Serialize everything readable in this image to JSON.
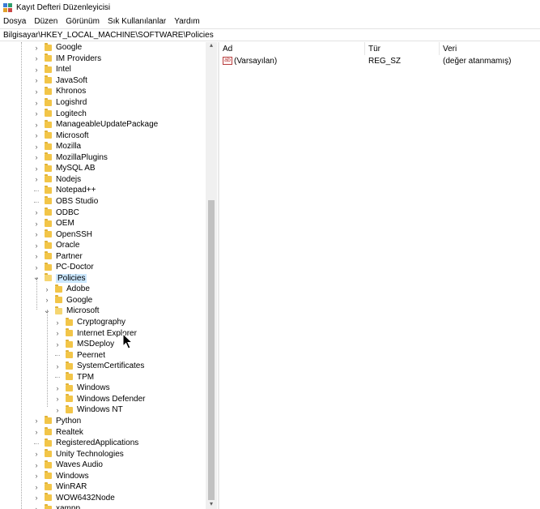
{
  "window": {
    "title": "Kayıt Defteri Düzenleyicisi"
  },
  "menu": [
    "Dosya",
    "Düzen",
    "Görünüm",
    "Sık Kullanılanlar",
    "Yardım"
  ],
  "address": "Bilgisayar\\HKEY_LOCAL_MACHINE\\SOFTWARE\\Policies",
  "tree": {
    "items": [
      {
        "label": "Google",
        "level": 1,
        "expanded": false,
        "has_children": true
      },
      {
        "label": "IM Providers",
        "level": 1,
        "expanded": false,
        "has_children": true
      },
      {
        "label": "Intel",
        "level": 1,
        "expanded": false,
        "has_children": true
      },
      {
        "label": "JavaSoft",
        "level": 1,
        "expanded": false,
        "has_children": true
      },
      {
        "label": "Khronos",
        "level": 1,
        "expanded": false,
        "has_children": true
      },
      {
        "label": "Logishrd",
        "level": 1,
        "expanded": false,
        "has_children": true
      },
      {
        "label": "Logitech",
        "level": 1,
        "expanded": false,
        "has_children": true
      },
      {
        "label": "ManageableUpdatePackage",
        "level": 1,
        "expanded": false,
        "has_children": true
      },
      {
        "label": "Microsoft",
        "level": 1,
        "expanded": false,
        "has_children": true
      },
      {
        "label": "Mozilla",
        "level": 1,
        "expanded": false,
        "has_children": true
      },
      {
        "label": "MozillaPlugins",
        "level": 1,
        "expanded": false,
        "has_children": true
      },
      {
        "label": "MySQL AB",
        "level": 1,
        "expanded": false,
        "has_children": true
      },
      {
        "label": "Nodejs",
        "level": 1,
        "expanded": false,
        "has_children": true
      },
      {
        "label": "Notepad++",
        "level": 1,
        "expanded": false,
        "has_children": false
      },
      {
        "label": "OBS Studio",
        "level": 1,
        "expanded": false,
        "has_children": false
      },
      {
        "label": "ODBC",
        "level": 1,
        "expanded": false,
        "has_children": true
      },
      {
        "label": "OEM",
        "level": 1,
        "expanded": false,
        "has_children": true
      },
      {
        "label": "OpenSSH",
        "level": 1,
        "expanded": false,
        "has_children": true
      },
      {
        "label": "Oracle",
        "level": 1,
        "expanded": false,
        "has_children": true
      },
      {
        "label": "Partner",
        "level": 1,
        "expanded": false,
        "has_children": true
      },
      {
        "label": "PC-Doctor",
        "level": 1,
        "expanded": false,
        "has_children": true
      },
      {
        "label": "Policies",
        "level": 1,
        "expanded": true,
        "has_children": true,
        "selected": true
      },
      {
        "label": "Adobe",
        "level": 2,
        "expanded": false,
        "has_children": true
      },
      {
        "label": "Google",
        "level": 2,
        "expanded": false,
        "has_children": true
      },
      {
        "label": "Microsoft",
        "level": 2,
        "expanded": true,
        "has_children": true
      },
      {
        "label": "Cryptography",
        "level": 3,
        "expanded": false,
        "has_children": true
      },
      {
        "label": "Internet Explorer",
        "level": 3,
        "expanded": false,
        "has_children": true
      },
      {
        "label": "MSDeploy",
        "level": 3,
        "expanded": false,
        "has_children": true
      },
      {
        "label": "Peernet",
        "level": 3,
        "expanded": false,
        "has_children": false
      },
      {
        "label": "SystemCertificates",
        "level": 3,
        "expanded": false,
        "has_children": true
      },
      {
        "label": "TPM",
        "level": 3,
        "expanded": false,
        "has_children": false
      },
      {
        "label": "Windows",
        "level": 3,
        "expanded": false,
        "has_children": true
      },
      {
        "label": "Windows Defender",
        "level": 3,
        "expanded": false,
        "has_children": true
      },
      {
        "label": "Windows NT",
        "level": 3,
        "expanded": false,
        "has_children": true
      },
      {
        "label": "Python",
        "level": 1,
        "expanded": false,
        "has_children": true
      },
      {
        "label": "Realtek",
        "level": 1,
        "expanded": false,
        "has_children": true
      },
      {
        "label": "RegisteredApplications",
        "level": 1,
        "expanded": false,
        "has_children": false
      },
      {
        "label": "Unity Technologies",
        "level": 1,
        "expanded": false,
        "has_children": true
      },
      {
        "label": "Waves Audio",
        "level": 1,
        "expanded": false,
        "has_children": true
      },
      {
        "label": "Windows",
        "level": 1,
        "expanded": false,
        "has_children": true
      },
      {
        "label": "WinRAR",
        "level": 1,
        "expanded": false,
        "has_children": true
      },
      {
        "label": "WOW6432Node",
        "level": 1,
        "expanded": false,
        "has_children": true
      },
      {
        "label": "xampp",
        "level": 1,
        "expanded": false,
        "has_children": true
      }
    ]
  },
  "values_pane": {
    "columns": {
      "name": "Ad",
      "type": "Tür",
      "data": "Veri"
    },
    "rows": [
      {
        "name": "(Varsayılan)",
        "type": "REG_SZ",
        "data": "(değer atanmamış)",
        "icon": "ab"
      }
    ]
  },
  "colors": {
    "selection": "#cce8ff",
    "folder": "#f2c548"
  }
}
